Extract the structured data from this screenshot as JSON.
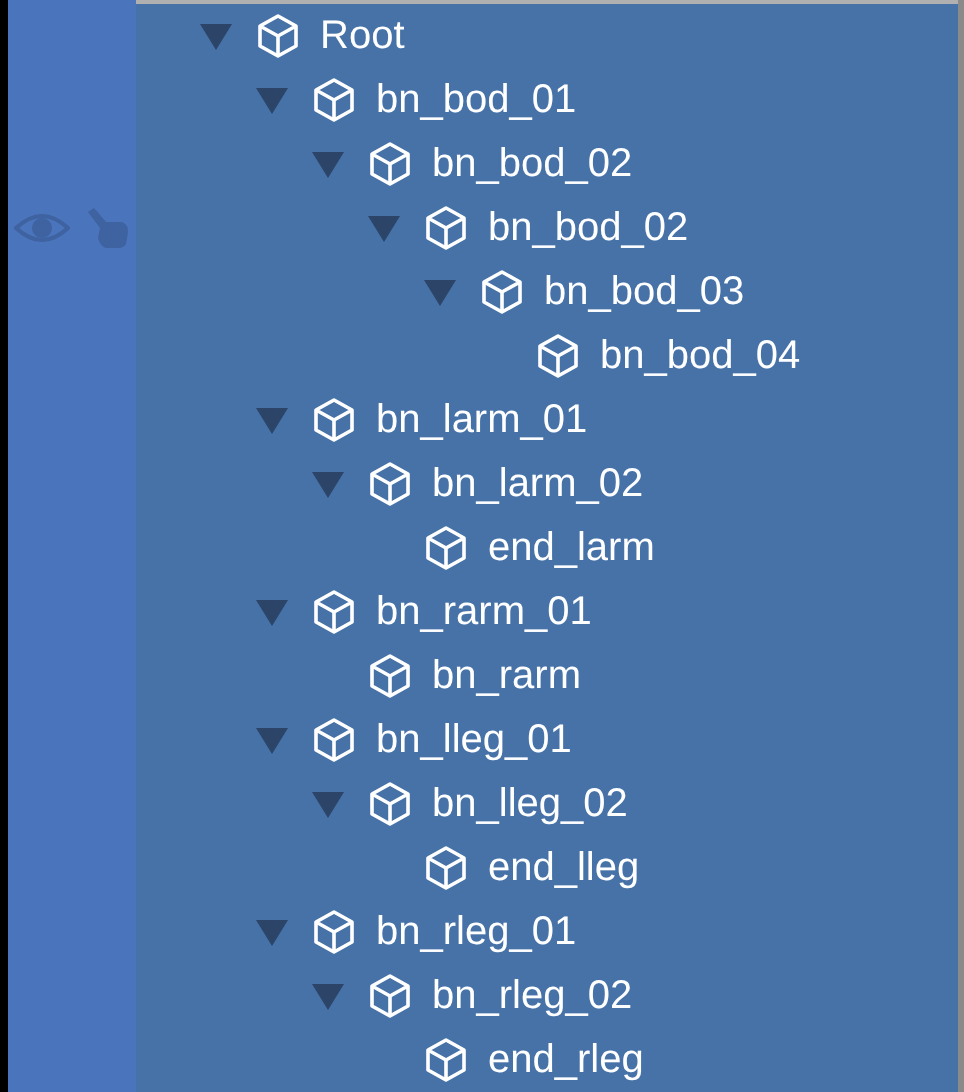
{
  "hierarchy": [
    {
      "name": "Root",
      "expanded": true,
      "hovered": false,
      "children": [
        {
          "name": "bn_bod_01",
          "expanded": true,
          "hovered": false,
          "children": [
            {
              "name": "bn_bod_02",
              "expanded": true,
              "hovered": false,
              "children": [
                {
                  "name": "bn_bod_02",
                  "expanded": true,
                  "hovered": true,
                  "children": [
                    {
                      "name": "bn_bod_03",
                      "expanded": true,
                      "hovered": false,
                      "children": [
                        {
                          "name": "bn_bod_04",
                          "hovered": false
                        }
                      ]
                    }
                  ]
                }
              ]
            }
          ]
        },
        {
          "name": "bn_larm_01",
          "expanded": true,
          "hovered": false,
          "children": [
            {
              "name": "bn_larm_02",
              "expanded": true,
              "hovered": false,
              "children": [
                {
                  "name": "end_larm",
                  "hovered": false
                }
              ]
            }
          ]
        },
        {
          "name": "bn_rarm_01",
          "expanded": true,
          "hovered": false,
          "children": [
            {
              "name": "bn_rarm",
              "hovered": false
            }
          ]
        },
        {
          "name": "bn_lleg_01",
          "expanded": true,
          "hovered": false,
          "children": [
            {
              "name": "bn_lleg_02",
              "expanded": true,
              "hovered": false,
              "children": [
                {
                  "name": "end_lleg",
                  "hovered": false
                }
              ]
            }
          ]
        },
        {
          "name": "bn_rleg_01",
          "expanded": true,
          "hovered": false,
          "children": [
            {
              "name": "bn_rleg_02",
              "expanded": true,
              "hovered": false,
              "children": [
                {
                  "name": "end_rleg",
                  "hovered": false
                }
              ]
            }
          ]
        }
      ]
    }
  ]
}
